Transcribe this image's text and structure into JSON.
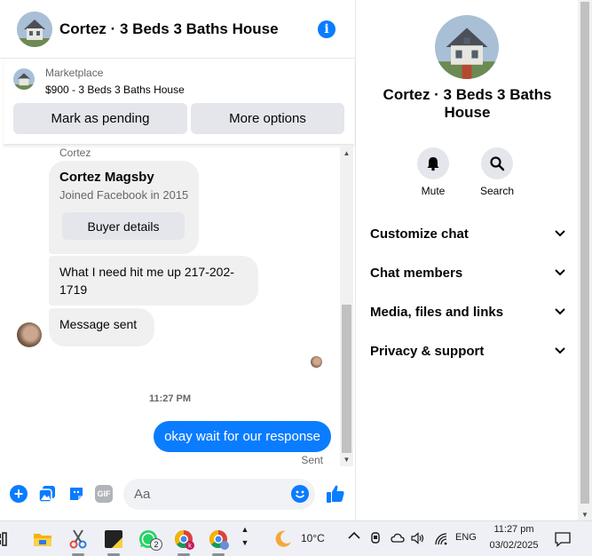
{
  "chat_header": {
    "title": "Cortez · 3 Beds 3 Baths House"
  },
  "marketplace": {
    "label": "Marketplace",
    "item": "$900 - 3 Beds 3 Baths House",
    "pending_button": "Mark as pending",
    "more_button": "More options"
  },
  "messages": {
    "sender_name": "Cortez",
    "profile_name": "Cortez Magsby",
    "profile_joined": "Joined Facebook in 2015",
    "buyer_details_button": "Buyer details",
    "msg1": "What I need hit me up 217-202-1719",
    "msg2": "Message sent",
    "timestamp": "11:27 PM",
    "outgoing": "okay wait for our response",
    "status": "Sent"
  },
  "composer": {
    "placeholder": "Aa",
    "gif_label": "GIF"
  },
  "details": {
    "title": "Cortez · 3 Beds 3 Baths House",
    "mute_label": "Mute",
    "search_label": "Search",
    "rows": [
      "Customize chat",
      "Chat members",
      "Media, files and links",
      "Privacy & support"
    ]
  },
  "taskbar": {
    "whatsapp_badge": "2",
    "temperature": "10°C",
    "language": "ENG",
    "time": "11:27 pm",
    "date": "03/02/2025"
  },
  "icons": {
    "info": "info-icon",
    "mute": "bell-icon",
    "search": "search-icon",
    "chevrons": "chevron-down-icon",
    "composer": [
      "plus-icon",
      "photo-icon",
      "sticker-icon",
      "gif-icon",
      "emoji-icon",
      "thumbs-up-icon"
    ],
    "taskbar": [
      "widgets-icon",
      "file-explorer-icon",
      "snipping-tool-icon",
      "sticky-notes-icon",
      "whatsapp-icon",
      "chrome-profile-k-icon",
      "chrome-profile-icon",
      "show-hidden-icons-icon",
      "weather-moon-icon",
      "notification-center-icon"
    ]
  },
  "colors": {
    "messenger_blue": "#0a7cff",
    "bubble_gray": "#f0f0f0",
    "button_gray": "#e4e6eb",
    "secondary_text": "#65676b"
  }
}
